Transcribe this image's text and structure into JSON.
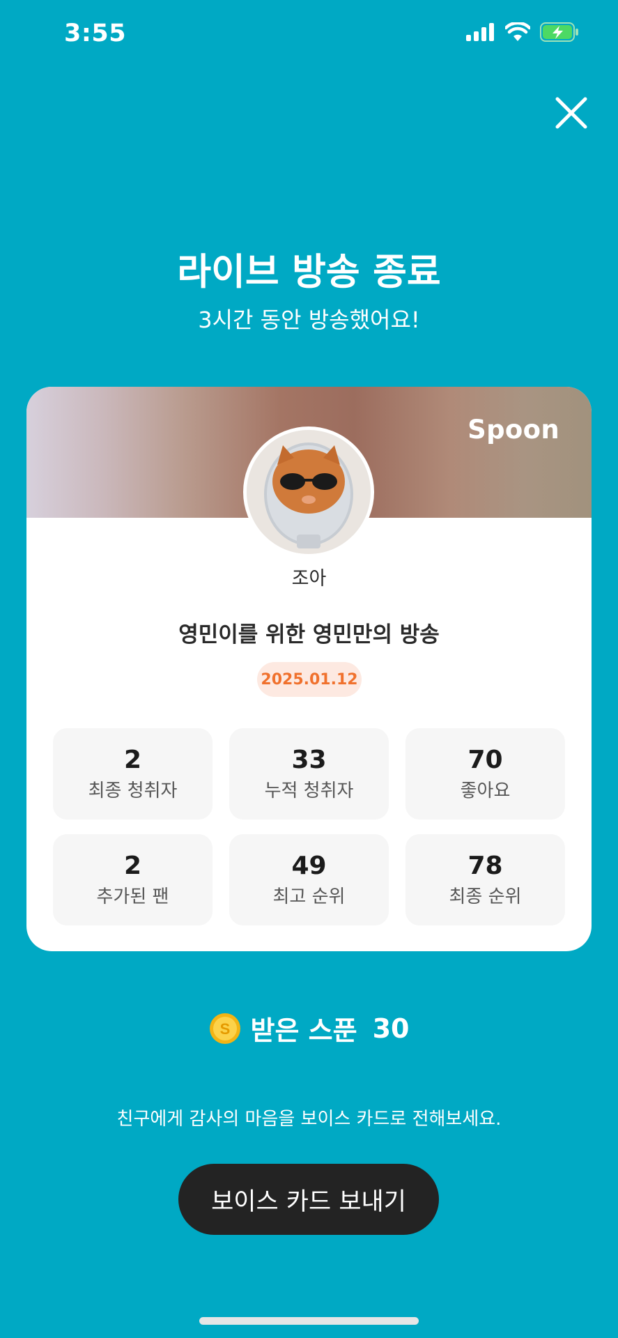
{
  "status_bar": {
    "time": "3:55",
    "icons": [
      "cellular-signal-icon",
      "wifi-icon",
      "battery-charging-icon"
    ]
  },
  "header": {
    "title": "라이브 방송 종료",
    "subtitle": "3시간 동안 방송했어요!",
    "close_icon": "close-icon"
  },
  "card": {
    "brand": "Spoon",
    "username": "조아",
    "broadcast_title": "영민이를 위한 영민만의 방송",
    "date": "2025.01.12",
    "stats": [
      {
        "value": "2",
        "label": "최종 청취자"
      },
      {
        "value": "33",
        "label": "누적 청취자"
      },
      {
        "value": "70",
        "label": "좋아요"
      },
      {
        "value": "2",
        "label": "추가된 팬"
      },
      {
        "value": "49",
        "label": "최고 순위"
      },
      {
        "value": "78",
        "label": "최종 순위"
      }
    ]
  },
  "spoons": {
    "icon": "spoon-coin-icon",
    "label": "받은 스푼",
    "count": "30"
  },
  "thanks_message": "친구에게 감사의 마음을 보이스 카드로 전해보세요.",
  "voice_card_button": "보이스 카드 보내기",
  "colors": {
    "background": "#00a9c4",
    "date_badge_text": "#f0712d",
    "button": "#232323"
  }
}
